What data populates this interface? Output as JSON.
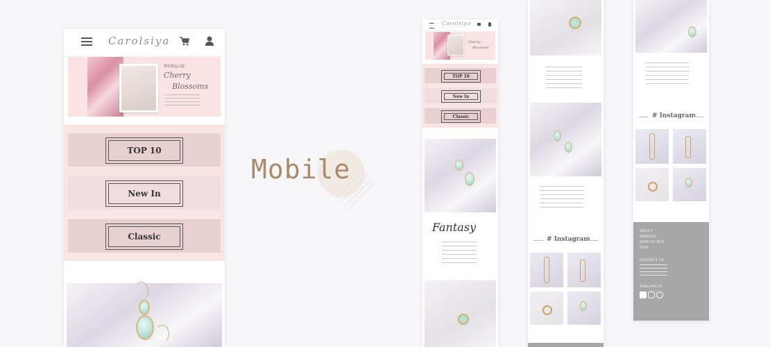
{
  "label": "Mobile",
  "brand": "Carolsiya",
  "banner": {
    "subtitle": "櫻花飾品公開",
    "title_line1": "Cherry",
    "title_line2": "Blossoms"
  },
  "categories": [
    "TOP 10",
    "New In",
    "Classic"
  ],
  "fantasy_title": "Fantasy",
  "instagram_heading": "# Instagram",
  "footer": {
    "links": [
      "ABOUT",
      "SERVICE",
      "HOW TO BUY",
      "VVIP"
    ],
    "contact_heading": "CONTACT US",
    "follow_heading": "FOLLOW US"
  },
  "colors": {
    "accent": "#a98a6a",
    "pink": "#f9e5e6",
    "footer": "#a7a7a7"
  },
  "icons": [
    "menu-icon",
    "cart-icon",
    "user-icon",
    "facebook-icon",
    "instagram-icon",
    "line-icon"
  ]
}
